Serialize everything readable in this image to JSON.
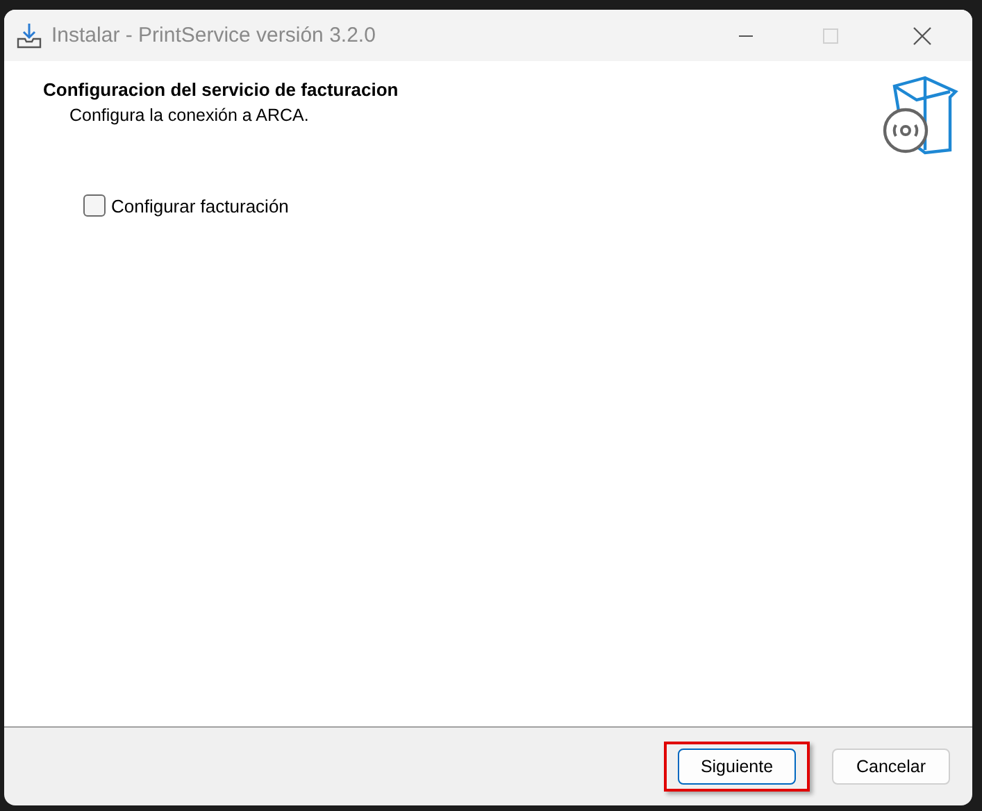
{
  "window": {
    "title": "Instalar - PrintService versión 3.2.0",
    "maximize_disabled": true
  },
  "header": {
    "title": "Configuracion del servicio de facturacion",
    "subtitle": "Configura la conexión a ARCA."
  },
  "options": [
    {
      "kind": "checkbox",
      "label": "Configurar facturación",
      "checked": false
    }
  ],
  "buttons": [
    {
      "label": "Siguiente",
      "default": true,
      "highlighted": true
    },
    {
      "label": "Cancelar",
      "default": false,
      "highlighted": false
    }
  ]
}
